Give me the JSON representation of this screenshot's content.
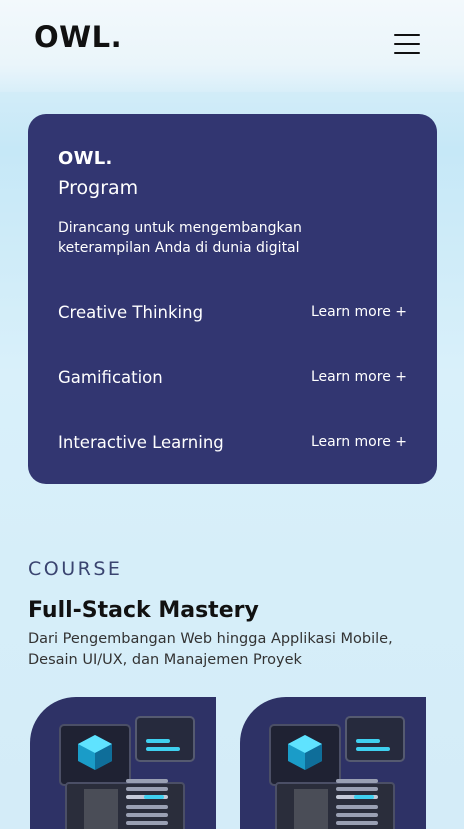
{
  "header": {
    "logo": "OWL.",
    "menu_icon": "hamburger-menu-icon"
  },
  "program": {
    "logo": "OWL.",
    "title": "Program",
    "description": "Dirancang untuk mengembangkan keterampilan Anda di dunia digital",
    "items": [
      {
        "label": "Creative Thinking",
        "link": "Learn more +"
      },
      {
        "label": "Gamification",
        "link": "Learn more +"
      },
      {
        "label": "Interactive Learning",
        "link": "Learn more +"
      }
    ]
  },
  "course": {
    "eyebrow": "COURSE",
    "title": "Full-Stack Mastery",
    "description": "Dari Pengembangan Web hingga Applikasi Mobile, Desain UI/UX, dan Manajemen Proyek"
  },
  "colors": {
    "card_bg": "#323671",
    "accent_cyan": "#3fd0f0"
  }
}
